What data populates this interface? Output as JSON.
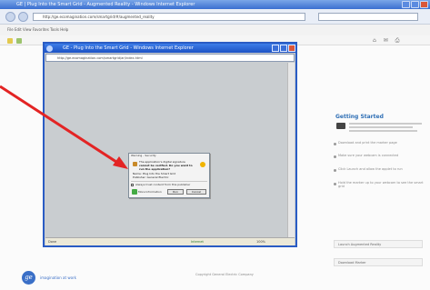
{
  "browser": {
    "title": "GE | Plug Into the Smart Grid - Augmented Reality - Windows Internet Explorer",
    "address": "http://ge.ecomagination.com/smartgrid/#/augmented_reality",
    "command_bar": "File   Edit   View   Favorites   Tools   Help"
  },
  "popup": {
    "title": "GE - Plug Into the Smart Grid - Windows Internet Explorer",
    "address": "http://ge.ecomagination.com/smartgrid/ar/index.html",
    "status_left": "Done",
    "zone": "Internet",
    "zoom": "100%"
  },
  "dialog": {
    "title": "Warning - Security",
    "line1": "The application's digital signature",
    "line2": "cannot be verified. Do you want to",
    "line3": "run the application?",
    "line4": "Name: Plug Into the Smart Grid",
    "line5": "Publisher: General Electric",
    "checkbox_label": "Always trust content from this publisher",
    "more_info": "More Information",
    "run_label": "Run",
    "cancel_label": "Cancel"
  },
  "side_panel": {
    "title": "Getting Started",
    "items": [
      "Download and print the marker page",
      "Make sure your webcam is connected",
      "Click Launch and allow the applet to run",
      "Hold the marker up to your webcam to see the smart grid"
    ],
    "box1": "Launch Augmented Reality",
    "box2": "Download Marker"
  },
  "footer": {
    "brand": "imagination at work",
    "text": "Copyright General Electric Company"
  },
  "colors": {
    "arrow": "#e32424",
    "title_bar": "#1c52c4",
    "accent": "#2f6fb5"
  }
}
